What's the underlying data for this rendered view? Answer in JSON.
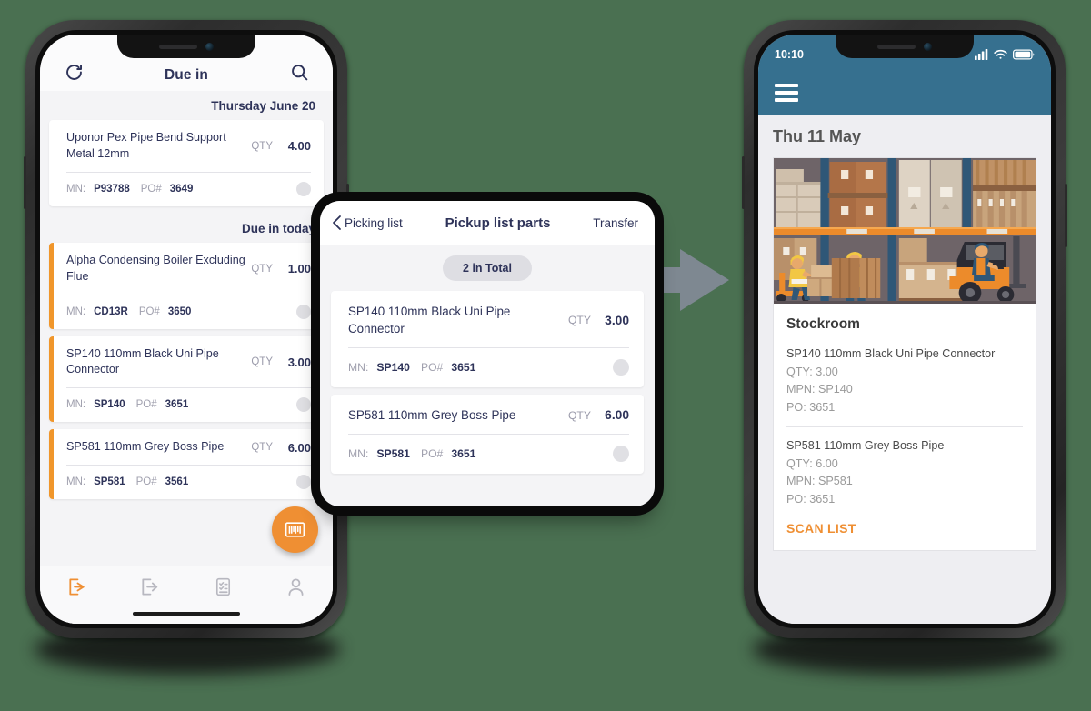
{
  "background_color": "#4a7051",
  "accent_orange": "#ef8f33",
  "navy": "#2e3359",
  "teal_header": "#36708f",
  "left_phone": {
    "name": "due-in-screen",
    "topbar": {
      "refresh_icon": "refresh-icon",
      "title": "Due in",
      "search_icon": "search-icon"
    },
    "sections": [
      {
        "heading": "Thursday June 20",
        "items": [
          {
            "name": "Uponor Pex Pipe Bend Support Metal 12mm",
            "qty_label": "QTY",
            "qty": "4.00",
            "mn_label": "MN:",
            "mn": "P93788",
            "po_label": "PO#",
            "po": "3649",
            "accent": false
          }
        ]
      },
      {
        "heading": "Due in today",
        "items": [
          {
            "name": "Alpha Condensing Boiler Excluding Flue",
            "qty_label": "QTY",
            "qty": "1.00",
            "mn_label": "MN:",
            "mn": "CD13R",
            "po_label": "PO#",
            "po": "3650",
            "accent": true
          },
          {
            "name": "SP140 110mm Black Uni Pipe Connector",
            "qty_label": "QTY",
            "qty": "3.00",
            "mn_label": "MN:",
            "mn": "SP140",
            "po_label": "PO#",
            "po": "3651",
            "accent": true
          },
          {
            "name": "SP581 110mm Grey Boss Pipe",
            "qty_label": "QTY",
            "qty": "6.00",
            "mn_label": "MN:",
            "mn": "SP581",
            "po_label": "PO#",
            "po": "3561",
            "accent": true
          }
        ]
      }
    ],
    "fab": {
      "icon": "barcode-scan-icon"
    },
    "tabbar": [
      {
        "icon": "goods-in-icon",
        "active": true
      },
      {
        "icon": "goods-out-icon",
        "active": false
      },
      {
        "icon": "checklist-icon",
        "active": false
      },
      {
        "icon": "person-icon",
        "active": false
      }
    ]
  },
  "overlay_card": {
    "name": "pickup-list-parts-card",
    "back_label": "Picking list",
    "back_icon": "chevron-left-icon",
    "title": "Pickup list parts",
    "action_label": "Transfer",
    "total_pill": "2 in Total",
    "items": [
      {
        "name": "SP140 110mm Black Uni Pipe Connector",
        "qty_label": "QTY",
        "qty": "3.00",
        "mn_label": "MN:",
        "mn": "SP140",
        "po_label": "PO#",
        "po": "3651"
      },
      {
        "name": "SP581 110mm Grey Boss Pipe",
        "qty_label": "QTY",
        "qty": "6.00",
        "mn_label": "MN:",
        "mn": "SP581",
        "po_label": "PO#",
        "po": "3651"
      }
    ]
  },
  "arrow": {
    "name": "flow-arrow-right",
    "color": "#7e8891"
  },
  "right_phone": {
    "name": "stockroom-screen",
    "status": {
      "time": "10:10",
      "signal_icon": "cellular-signal-icon",
      "wifi_icon": "wifi-icon",
      "battery_icon": "battery-icon"
    },
    "appbar": {
      "menu_icon": "hamburger-menu-icon"
    },
    "date": "Thu 11 May",
    "hero_image": "warehouse-illustration",
    "card_title": "Stockroom",
    "items": [
      {
        "name": "SP140 110mm Black Uni Pipe Connector",
        "qty": "QTY: 3.00",
        "mpn": "MPN: SP140",
        "po": "PO: 3651"
      },
      {
        "name": "SP581 110mm Grey Boss Pipe",
        "qty": "QTY: 6.00",
        "mpn": "MPN: SP581",
        "po": "PO: 3651"
      }
    ],
    "scan_link": "SCAN LIST"
  }
}
